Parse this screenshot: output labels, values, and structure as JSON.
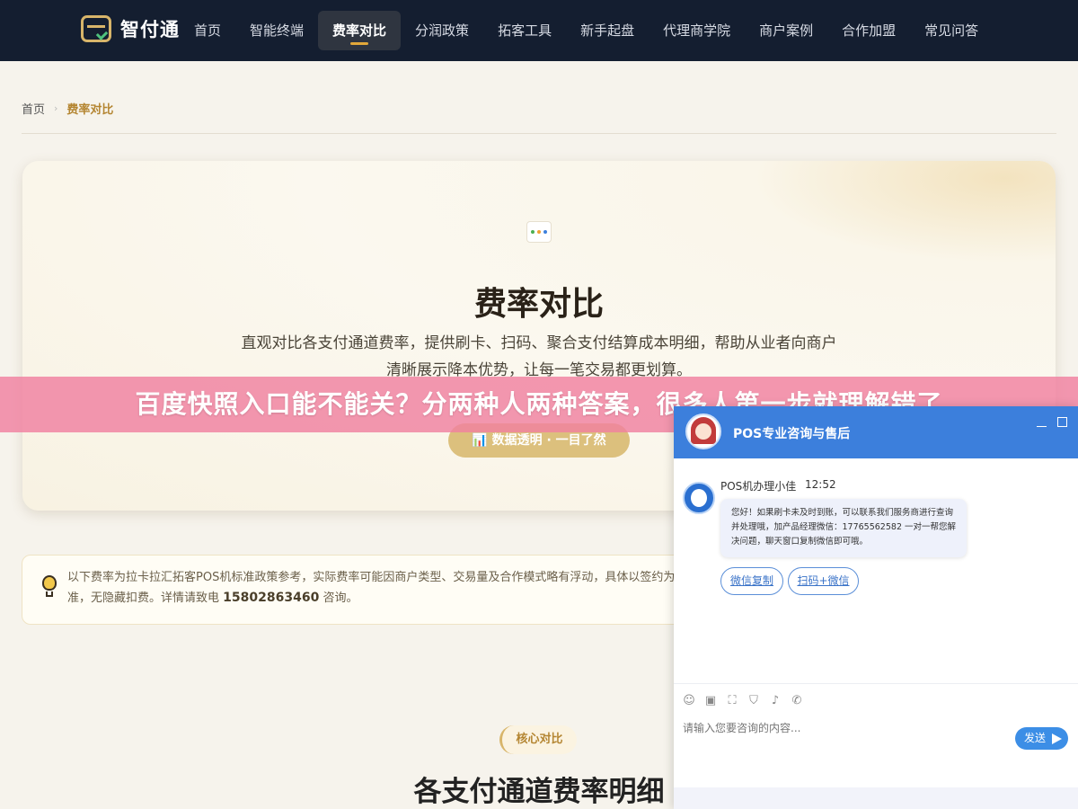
{
  "nav": {
    "logo_text": "智付通",
    "items": [
      "首页",
      "智能终端",
      "费率对比",
      "分润政策",
      "拓客工具",
      "新手起盘",
      "代理商学院",
      "商户案例",
      "合作加盟",
      "常见问答"
    ],
    "active_index": 2
  },
  "breadcrumb": {
    "home": "首页",
    "current": "费率对比"
  },
  "hero": {
    "title": "费率对比",
    "desc_line1": "直观对比各支付通道费率，提供刷卡、扫码、聚合支付结算成本明细，帮助从业者向商户",
    "desc_line2": "清晰展示降本优势，让每一笔交易都更划算。",
    "badge": "📊 数据透明 · 一目了然"
  },
  "notice": {
    "text": "以下费率为拉卡拉汇拓客POS机标准政策参考，实际费率可能因商户类型、交易量及合作模式略有浮动，具体以签约为准，无隐藏扣费。详情请致电",
    "phone": "15802863460",
    "suffix": "咨询。"
  },
  "section": {
    "tag": "核心对比",
    "title": "各支付通道费率明细"
  },
  "banner": "百度快照入口能不能关？分两种人两种答案，很多人第一步就理解错了",
  "chat": {
    "title": "POS专业咨询与售后",
    "agent_name": "POS机办理小佳",
    "time": "12:52",
    "message": "您好！如果刷卡未及时到账，可以联系我们服务商进行查询并处理哦，加产品经理微信：17765562582 一对一帮您解决问题，聊天窗口复制微信即可哦。",
    "quick_replies": [
      "微信复制",
      "扫码+微信"
    ],
    "input_placeholder": "请输入您要咨询的内容...",
    "send_label": "发送"
  },
  "colors": {
    "nav_bg": "#141e30",
    "accent_gold": "#b48531",
    "banner_pink": "#f080a0",
    "chat_blue": "#3c7fdc"
  }
}
